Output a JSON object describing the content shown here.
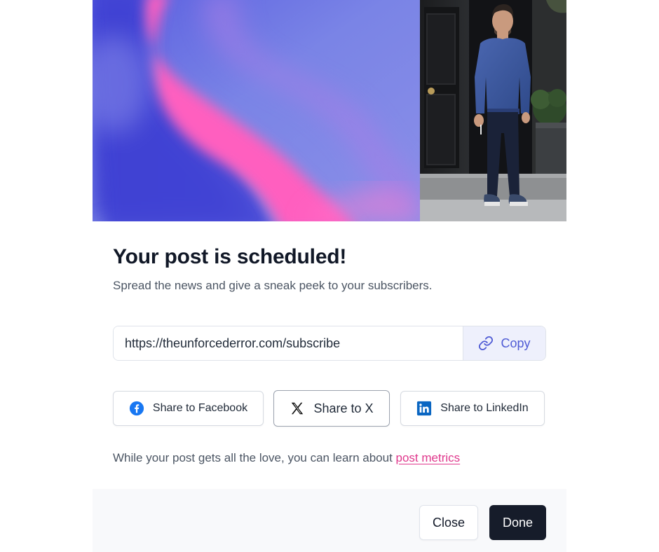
{
  "dialog": {
    "title": "Your post is scheduled!",
    "subtitle": "Spread the news and give a sneak peek to your subscribers."
  },
  "share_link": {
    "url": "https://theunforcederror.com/subscribe",
    "copy_label": "Copy",
    "copy_icon": "link-icon"
  },
  "share_buttons": {
    "facebook_label": "Share to Facebook",
    "facebook_icon": "facebook-icon",
    "x_label": "Share to X",
    "x_icon": "x-logo-icon",
    "linkedin_label": "Share to LinkedIn",
    "linkedin_icon": "linkedin-icon"
  },
  "note": {
    "text": "While your post gets all the love, you can learn about ",
    "link_label": "post metrics"
  },
  "footer": {
    "close_label": "Close",
    "done_label": "Done"
  },
  "colors": {
    "accent": "#4f5bd5",
    "copy_bg": "#eef0fc",
    "link_pink": "#e0378c",
    "done_bg": "#161c2a",
    "facebook_blue": "#1877f2",
    "linkedin_blue": "#0a66c2",
    "footer_bg": "#f8f9fb"
  }
}
